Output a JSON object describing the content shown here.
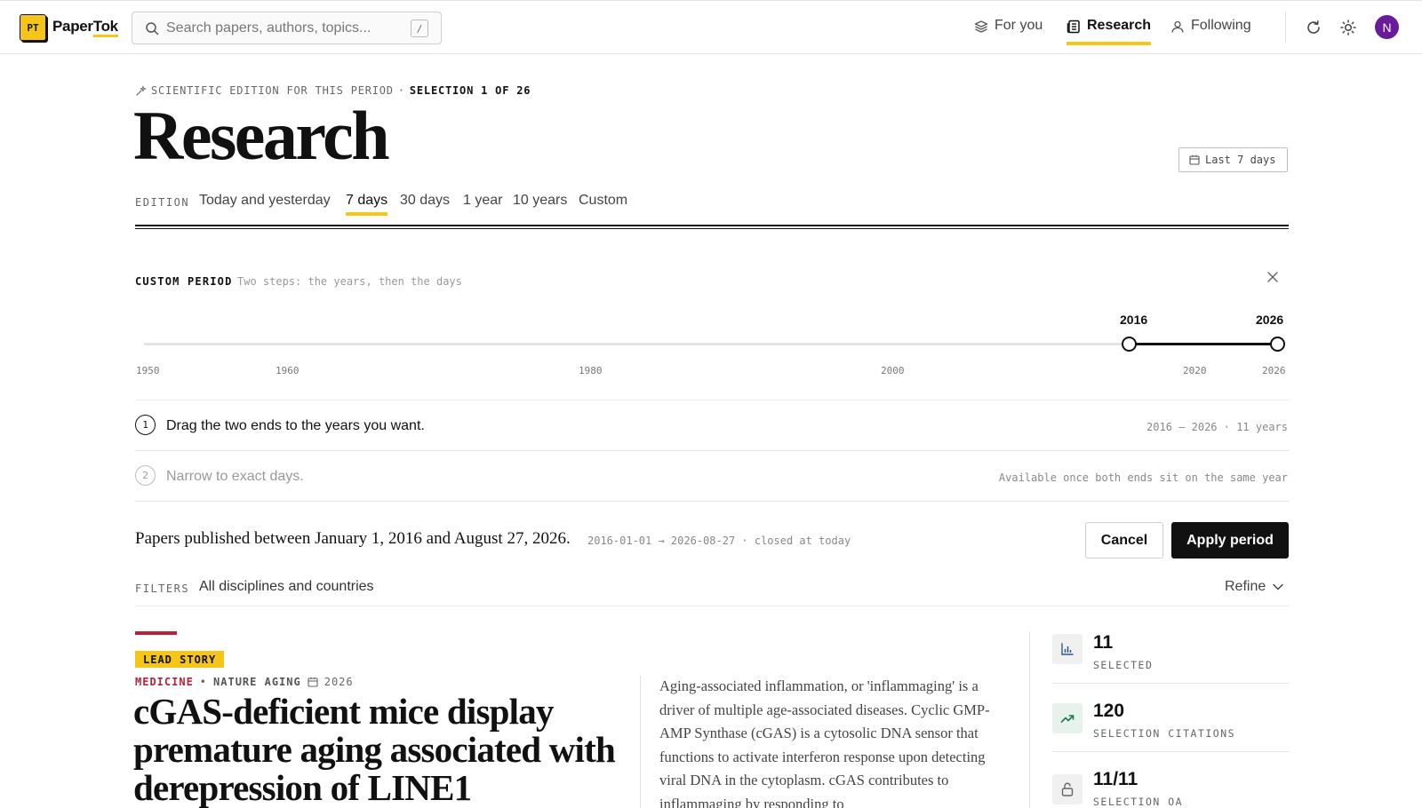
{
  "app": {
    "logo_initials": "PT",
    "name_part1": "Paper",
    "name_part2": "Tok"
  },
  "search": {
    "placeholder": "Search papers, authors, topics...",
    "shortcut": "/"
  },
  "nav": {
    "items": [
      {
        "label": "For you",
        "icon": "layers-icon"
      },
      {
        "label": "Research",
        "icon": "newspaper-icon",
        "active": true
      },
      {
        "label": "Following",
        "icon": "user-icon"
      }
    ],
    "avatar_initial": "N"
  },
  "header": {
    "kicker": "SCIENTIFIC EDITION FOR THIS PERIOD",
    "selection": "SELECTION 1 OF 26",
    "title": "Research",
    "date_badge": "Last 7 days"
  },
  "edition": {
    "label": "EDITION",
    "tabs": [
      "Today and yesterday",
      "7 days",
      "30 days",
      "1 year",
      "10 years",
      "Custom"
    ],
    "active_index": 1
  },
  "custom_period": {
    "label": "CUSTOM PERIOD",
    "hint": "Two steps: the years, then the days",
    "range_start": "2016",
    "range_end": "2026",
    "ticks": [
      "1950",
      "1960",
      "1980",
      "2000",
      "2020",
      "2026"
    ],
    "steps": [
      {
        "num": "1",
        "text": "Drag the two ends to the years you want.",
        "meta": "2016 — 2026 · 11 years"
      },
      {
        "num": "2",
        "text": "Narrow to exact days.",
        "meta": "Available once both ends sit on the same year"
      }
    ],
    "summary": "Papers published between January 1, 2016 and August 27, 2026.",
    "summary_range": "2016-01-01 → 2026-08-27 · closed at today",
    "cancel_label": "Cancel",
    "apply_label": "Apply period"
  },
  "filters": {
    "label": "FILTERS",
    "value": "All disciplines and countries",
    "refine_label": "Refine"
  },
  "lead_story": {
    "badge": "LEAD STORY",
    "discipline": "MEDICINE",
    "journal": "NATURE AGING",
    "year": "2026",
    "title": "cGAS-deficient mice display premature aging associated with derepression of LINE1",
    "abstract": "Aging-associated inflammation, or 'inflammaging' is a driver of multiple age-associated diseases. Cyclic GMP-AMP Synthase (cGAS) is a cytosolic DNA sensor that functions to activate interferon response upon detecting viral DNA in the cytoplasm. cGAS contributes to inflammaging by responding to"
  },
  "stats": [
    {
      "value": "11",
      "label": "SELECTED",
      "icon": "bar-chart-icon"
    },
    {
      "value": "120",
      "label": "SELECTION CITATIONS",
      "icon": "trending-up-icon"
    },
    {
      "value": "11/11",
      "label": "SELECTION OA",
      "icon": "unlock-icon"
    }
  ],
  "colors": {
    "accent": "#f5c518",
    "medicine": "#b5243c",
    "avatar": "#6a1b9a",
    "ink": "#111111"
  }
}
